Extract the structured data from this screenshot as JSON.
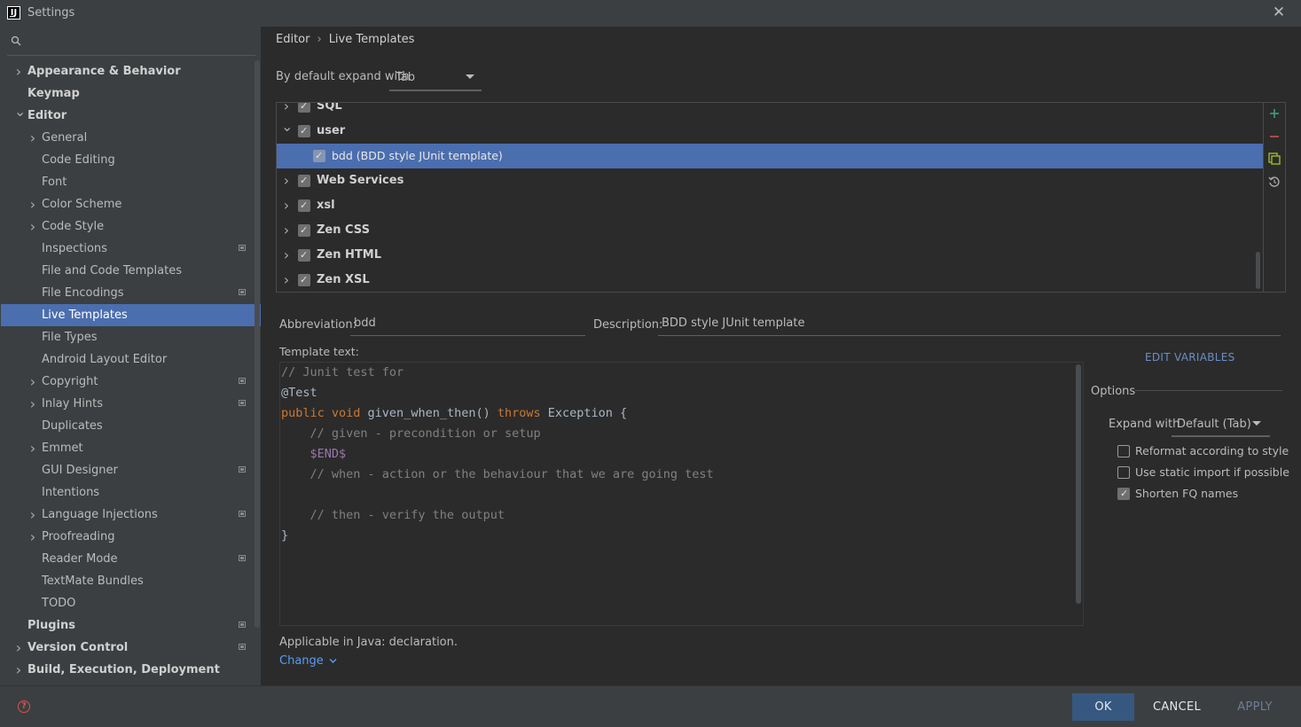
{
  "window": {
    "title": "Settings"
  },
  "search": {
    "placeholder": ""
  },
  "sidebar": {
    "items": [
      {
        "label": "Appearance & Behavior",
        "bold": true,
        "chevron": "right",
        "level": 0
      },
      {
        "label": "Keymap",
        "bold": true,
        "chevron": "",
        "level": 0
      },
      {
        "label": "Editor",
        "bold": true,
        "chevron": "down",
        "level": 0
      },
      {
        "label": "General",
        "chevron": "right",
        "level": 1
      },
      {
        "label": "Code Editing",
        "chevron": "",
        "level": 1
      },
      {
        "label": "Font",
        "chevron": "",
        "level": 1
      },
      {
        "label": "Color Scheme",
        "chevron": "right",
        "level": 1
      },
      {
        "label": "Code Style",
        "chevron": "right",
        "level": 1
      },
      {
        "label": "Inspections",
        "chevron": "",
        "level": 1,
        "project": true
      },
      {
        "label": "File and Code Templates",
        "chevron": "",
        "level": 1
      },
      {
        "label": "File Encodings",
        "chevron": "",
        "level": 1,
        "project": true
      },
      {
        "label": "Live Templates",
        "chevron": "",
        "level": 1,
        "selected": true
      },
      {
        "label": "File Types",
        "chevron": "",
        "level": 1
      },
      {
        "label": "Android Layout Editor",
        "chevron": "",
        "level": 1
      },
      {
        "label": "Copyright",
        "chevron": "right",
        "level": 1,
        "project": true
      },
      {
        "label": "Inlay Hints",
        "chevron": "right",
        "level": 1,
        "project": true
      },
      {
        "label": "Duplicates",
        "chevron": "",
        "level": 1
      },
      {
        "label": "Emmet",
        "chevron": "right",
        "level": 1
      },
      {
        "label": "GUI Designer",
        "chevron": "",
        "level": 1,
        "project": true
      },
      {
        "label": "Intentions",
        "chevron": "",
        "level": 1
      },
      {
        "label": "Language Injections",
        "chevron": "right",
        "level": 1,
        "project": true
      },
      {
        "label": "Proofreading",
        "chevron": "right",
        "level": 1
      },
      {
        "label": "Reader Mode",
        "chevron": "",
        "level": 1,
        "project": true
      },
      {
        "label": "TextMate Bundles",
        "chevron": "",
        "level": 1
      },
      {
        "label": "TODO",
        "chevron": "",
        "level": 1
      },
      {
        "label": "Plugins",
        "bold": true,
        "chevron": "",
        "level": 0,
        "project": true
      },
      {
        "label": "Version Control",
        "bold": true,
        "chevron": "right",
        "level": 0,
        "project": true
      },
      {
        "label": "Build, Execution, Deployment",
        "bold": true,
        "chevron": "right",
        "level": 0
      }
    ]
  },
  "breadcrumb": {
    "parent": "Editor",
    "separator": "›",
    "current": "Live Templates"
  },
  "expand_default": {
    "label": "By default expand with",
    "value": "Tab"
  },
  "templates": [
    {
      "label": "SQL",
      "group": true,
      "chevron": "right",
      "checked": true
    },
    {
      "label": "user",
      "group": true,
      "chevron": "down",
      "checked": true
    },
    {
      "label": "bdd (BDD style JUnit template)",
      "group": false,
      "checked": true,
      "selected": true
    },
    {
      "label": "Web Services",
      "group": true,
      "chevron": "right",
      "checked": true
    },
    {
      "label": "xsl",
      "group": true,
      "chevron": "right",
      "checked": true
    },
    {
      "label": "Zen CSS",
      "group": true,
      "chevron": "right",
      "checked": true
    },
    {
      "label": "Zen HTML",
      "group": true,
      "chevron": "right",
      "checked": true
    },
    {
      "label": "Zen XSL",
      "group": true,
      "chevron": "right",
      "checked": true
    }
  ],
  "toolbar": {
    "add_icon": "plus-icon",
    "remove_icon": "minus-icon",
    "copy_icon": "copy-icon",
    "restore_icon": "restore-icon",
    "add_color": "#3f9d7a",
    "remove_color": "#c75450",
    "copy_color": "#9bbb29"
  },
  "abbreviation": {
    "label": "Abbreviation:",
    "value": "bdd"
  },
  "description": {
    "label": "Description:",
    "value": "BDD style JUnit template"
  },
  "template_text": {
    "label": "Template text:",
    "lines": [
      [
        {
          "t": "// Junit test for",
          "c": "comment"
        }
      ],
      [
        {
          "t": "@Test",
          "c": "txt"
        }
      ],
      [
        {
          "t": "public ",
          "c": "kw"
        },
        {
          "t": "void ",
          "c": "kw"
        },
        {
          "t": "given_when_then() ",
          "c": "txt"
        },
        {
          "t": "throws ",
          "c": "kw"
        },
        {
          "t": "Exception {",
          "c": "txt"
        }
      ],
      [
        {
          "t": "    // given - precondition or setup",
          "c": "comment"
        }
      ],
      [
        {
          "t": "    ",
          "c": "txt"
        },
        {
          "t": "$END$",
          "c": "var"
        }
      ],
      [
        {
          "t": "    // when - action or the behaviour that we are going test",
          "c": "comment"
        }
      ],
      [
        {
          "t": "",
          "c": "txt"
        }
      ],
      [
        {
          "t": "    // then - verify the output",
          "c": "comment"
        }
      ],
      [
        {
          "t": "}",
          "c": "txt"
        }
      ]
    ]
  },
  "edit_variables": "EDIT VARIABLES",
  "options": {
    "title": "Options",
    "expand_with_label": "Expand with",
    "expand_with_value": "Default (Tab)",
    "checkboxes": [
      {
        "label": "Reformat according to style",
        "checked": false
      },
      {
        "label": "Use static import if possible",
        "checked": false
      },
      {
        "label": "Shorten FQ names",
        "checked": true
      }
    ]
  },
  "applicable": "Applicable in Java: declaration.",
  "change_link": "Change",
  "buttons": {
    "ok": "OK",
    "cancel": "CANCEL",
    "apply": "APPLY"
  },
  "colors": {
    "accent": "#4b6eaf",
    "ok_button": "#365880",
    "link": "#589df6"
  }
}
